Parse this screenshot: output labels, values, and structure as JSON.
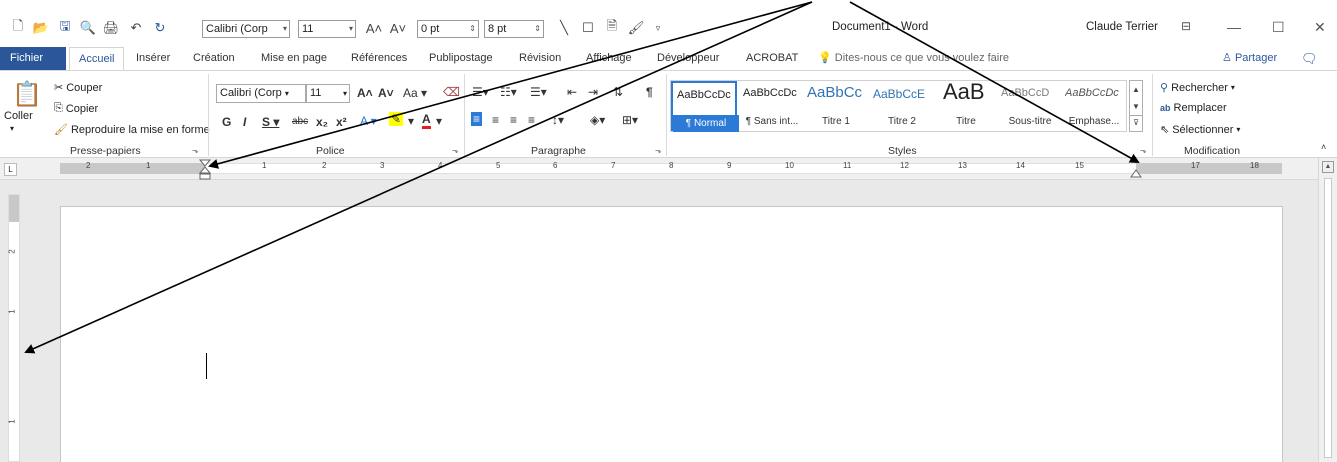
{
  "qat": {
    "font_name": "Calibri (Corp",
    "font_size": "11",
    "spacing_before": "0 pt",
    "spacing_after": "8 pt"
  },
  "title": {
    "document": "Document1 - Word",
    "user": "Claude Terrier"
  },
  "tabs": {
    "fichier": "Fichier",
    "accueil": "Accueil",
    "inserer": "Insérer",
    "creation": "Création",
    "mise_en_page": "Mise en page",
    "references": "Références",
    "publipostage": "Publipostage",
    "revision": "Révision",
    "affichage": "Affichage",
    "developpeur": "Développeur",
    "acrobat": "ACROBAT",
    "tell_me": "Dites-nous ce que vous voulez faire",
    "partager": "Partager"
  },
  "clipboard": {
    "coller": "Coller",
    "couper": "Couper",
    "copier": "Copier",
    "reproduire": "Reproduire la mise en forme",
    "label": "Presse-papiers"
  },
  "police": {
    "font_name": "Calibri (Corp",
    "font_size": "11",
    "case": "Aa",
    "label": "Police"
  },
  "paragraphe": {
    "label": "Paragraphe"
  },
  "styles": {
    "label": "Styles",
    "items": [
      {
        "sample": "AaBbCcDc",
        "name": "¶ Normal"
      },
      {
        "sample": "AaBbCcDc",
        "name": "¶ Sans int..."
      },
      {
        "sample": "AaBbCc",
        "name": "Titre 1"
      },
      {
        "sample": "AaBbCcE",
        "name": "Titre 2"
      },
      {
        "sample": "AaB",
        "name": "Titre"
      },
      {
        "sample": "AaBbCcD",
        "name": "Sous-titre"
      },
      {
        "sample": "AaBbCcDc",
        "name": "Emphase..."
      }
    ]
  },
  "modification": {
    "rechercher": "Rechercher",
    "remplacer": "Remplacer",
    "selectionner": "Sélectionner",
    "label": "Modification"
  },
  "ruler": {
    "tab_selector": "L",
    "left_numbers": [
      "2",
      "1"
    ],
    "numbers": [
      "1",
      "2",
      "3",
      "4",
      "5",
      "6",
      "7",
      "8",
      "9",
      "10",
      "11",
      "12",
      "13",
      "14",
      "15",
      "17",
      "18"
    ]
  },
  "vruler": {
    "numbers": [
      "2",
      "1",
      "1"
    ]
  },
  "colors": {
    "ribbon_blue": "#2b579a",
    "style_selected": "#2b7ad6",
    "highlight_yellow": "#ffff00",
    "font_red": "#e02020"
  }
}
